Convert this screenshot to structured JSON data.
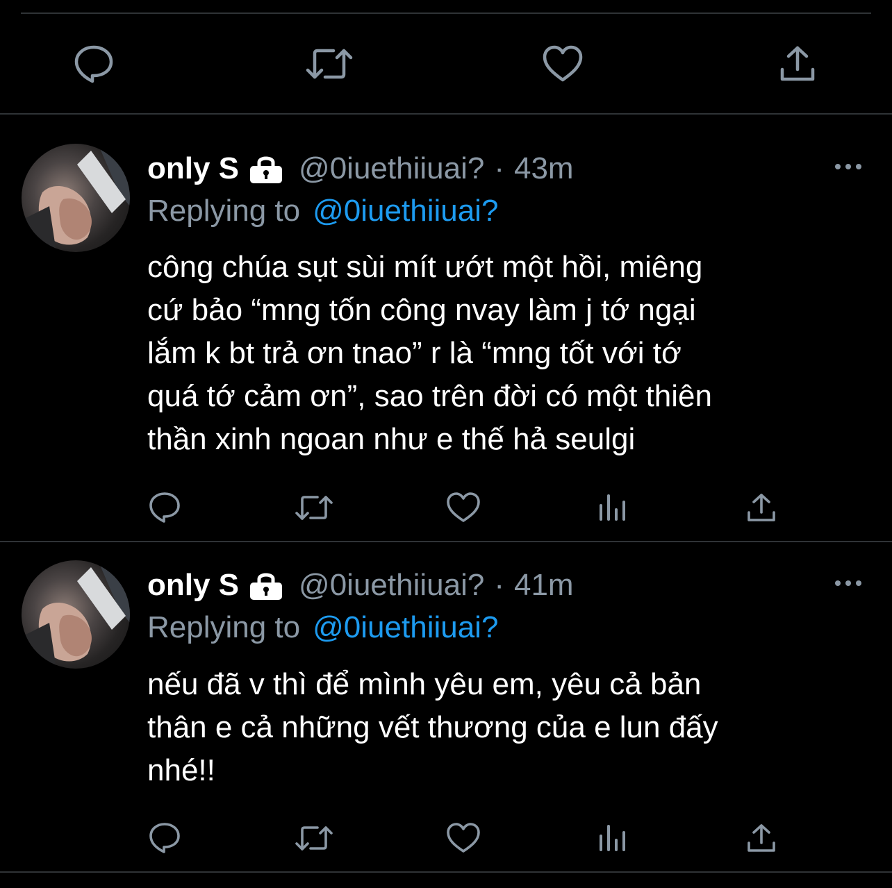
{
  "colors": {
    "background": "#000000",
    "divider": "#2f3336",
    "secondary_text": "#8b98a5",
    "link": "#1d9bf0",
    "icon": "#8b98a5"
  },
  "top_actions": {
    "icons": [
      "reply-icon",
      "retweet-icon",
      "like-icon",
      "share-icon"
    ]
  },
  "tweets": [
    {
      "display_name": "only S",
      "handle": "@0iuethiiuai?",
      "separator": "·",
      "time": "43m",
      "replying_prefix": "Replying to",
      "replying_to": "@0iuethiiuai?",
      "text_lines": [
        "công chúa sụt sùi mít ướt một hồi, miêng",
        "cứ bảo “mng tốn công nvay làm j tớ ngại",
        "lắm k bt trả ơn tnao” r là “mng tốt với tớ",
        "quá tớ cảm ơn”, sao trên đời có một thiên",
        "thần xinh ngoan như e thế hả seulgi"
      ],
      "icons": [
        "reply-icon",
        "retweet-icon",
        "like-icon",
        "analytics-icon",
        "share-icon"
      ]
    },
    {
      "display_name": "only S",
      "handle": "@0iuethiiuai?",
      "separator": "·",
      "time": "41m",
      "replying_prefix": "Replying to",
      "replying_to": "@0iuethiiuai?",
      "text_lines": [
        "nếu đã v thì để mình yêu em, yêu cả bản",
        "thân e cả những vết thương của e lun đấy",
        "nhé!!"
      ],
      "icons": [
        "reply-icon",
        "retweet-icon",
        "like-icon",
        "analytics-icon",
        "share-icon"
      ]
    }
  ]
}
